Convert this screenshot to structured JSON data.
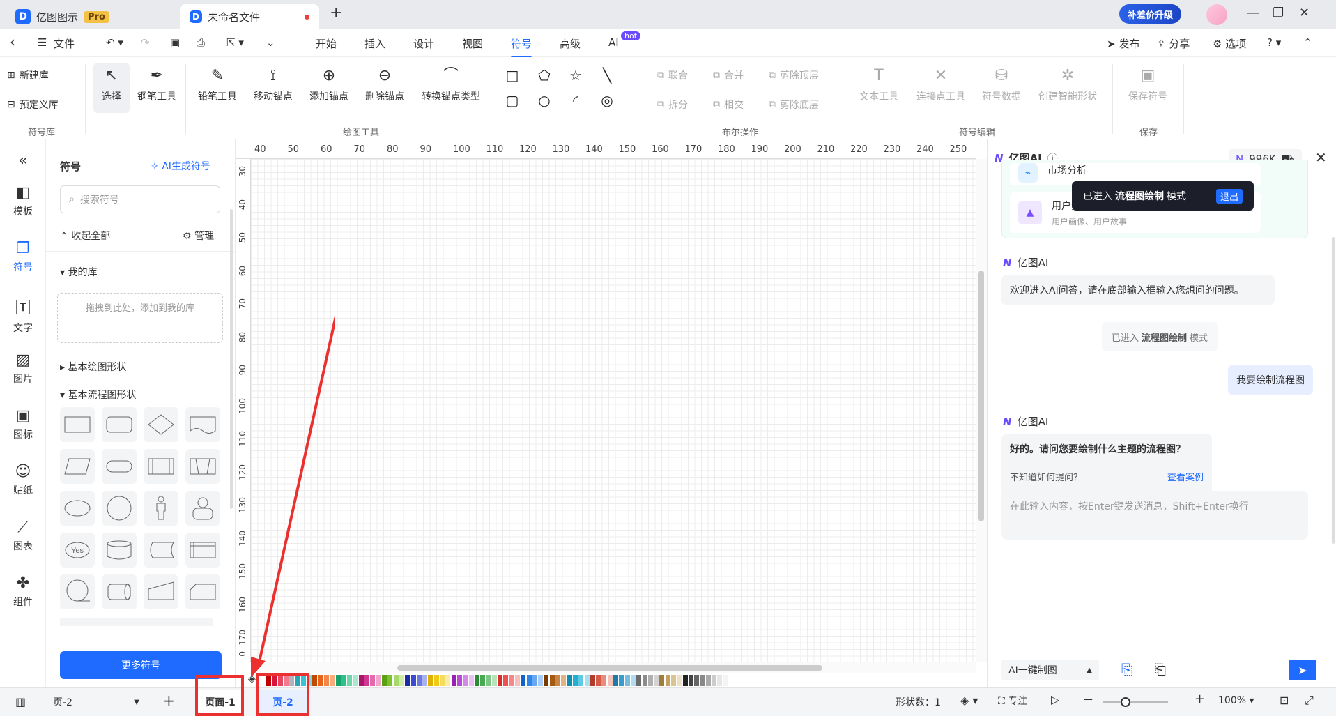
{
  "titlebar": {
    "app_name": "亿图图示",
    "pro": "Pro",
    "doc_tab": "未命名文件",
    "upgrade": "补差价升级"
  },
  "menubar": {
    "back": "‹",
    "file": "文件",
    "items": [
      "开始",
      "插入",
      "设计",
      "视图",
      "符号",
      "高级",
      "AI"
    ],
    "ai_badge": "hot",
    "publish": "发布",
    "share": "分享",
    "options": "选项"
  },
  "ribbon": {
    "lib_new": "新建库",
    "lib_preset": "预定义库",
    "group_lib": "符号库",
    "tools": [
      "选择",
      "钢笔工具",
      "铅笔工具",
      "移动锚点",
      "添加锚点",
      "删除锚点",
      "转换锚点类型"
    ],
    "group_draw": "绘图工具",
    "bool_ops": [
      "联合",
      "合并",
      "剪除顶层",
      "拆分",
      "相交",
      "剪除底层"
    ],
    "group_bool": "布尔操作",
    "edit": [
      "文本工具",
      "连接点工具",
      "符号数据",
      "创建智能形状"
    ],
    "group_edit": "符号编辑",
    "save": "保存符号",
    "group_save": "保存"
  },
  "leftnav": [
    "模板",
    "符号",
    "文字",
    "图片",
    "图标",
    "贴纸",
    "图表",
    "组件"
  ],
  "sympanel": {
    "title": "符号",
    "ai_gen": "AI生成符号",
    "search_placeholder": "搜索符号",
    "collapse": "收起全部",
    "manage": "管理",
    "my_lib": "我的库",
    "drop_hint": "拖拽到此处，添加到我的库",
    "basic_shapes": "基本绘图形状",
    "flow_shapes": "基本流程图形状",
    "yes_label": "Yes",
    "more": "更多符号"
  },
  "ruler": {
    "top": [
      "40",
      "50",
      "60",
      "70",
      "80",
      "90",
      "100",
      "110",
      "120",
      "130",
      "140",
      "150",
      "160",
      "170",
      "180",
      "190",
      "200",
      "210",
      "220",
      "230",
      "240",
      "250"
    ],
    "left": [
      "30",
      "40",
      "50",
      "60",
      "70",
      "80",
      "90",
      "100",
      "110",
      "120",
      "130",
      "140",
      "150",
      "160",
      "170",
      "0"
    ]
  },
  "aipanel": {
    "title": "亿图AI",
    "credits": "996K",
    "card1_title": "市场分析",
    "card2_title": "用户分析",
    "card2_sub": "用户画像、用户故事",
    "toast_pre": "已进入",
    "toast_mode": "流程图绘制",
    "toast_post": "模式",
    "toast_exit": "退出",
    "bot_name": "亿图AI",
    "welcome": "欢迎进入AI问答，请在底部输入框输入您想问的问题。",
    "mode_note_pre": "已进入",
    "mode_note_mode": "流程图绘制",
    "mode_note_post": "模式",
    "user_msg": "我要绘制流程图",
    "reply": "好的。请问您要绘制什么主题的流程图？",
    "reply_hint": "不知道如何提问？",
    "reply_link": "查看案例",
    "input_placeholder": "在此输入内容，按Enter键发送消息，Shift+Enter换行",
    "mode_select": "AI一键制图"
  },
  "statusbar": {
    "page_select": "页-2",
    "tab1": "页面-1",
    "tab2": "页-2",
    "shape_count": "形状数：1",
    "focus": "专注",
    "zoom": "100%"
  },
  "colors": {
    "accent": "#1f6bff",
    "annot": "#ec2f2f"
  }
}
